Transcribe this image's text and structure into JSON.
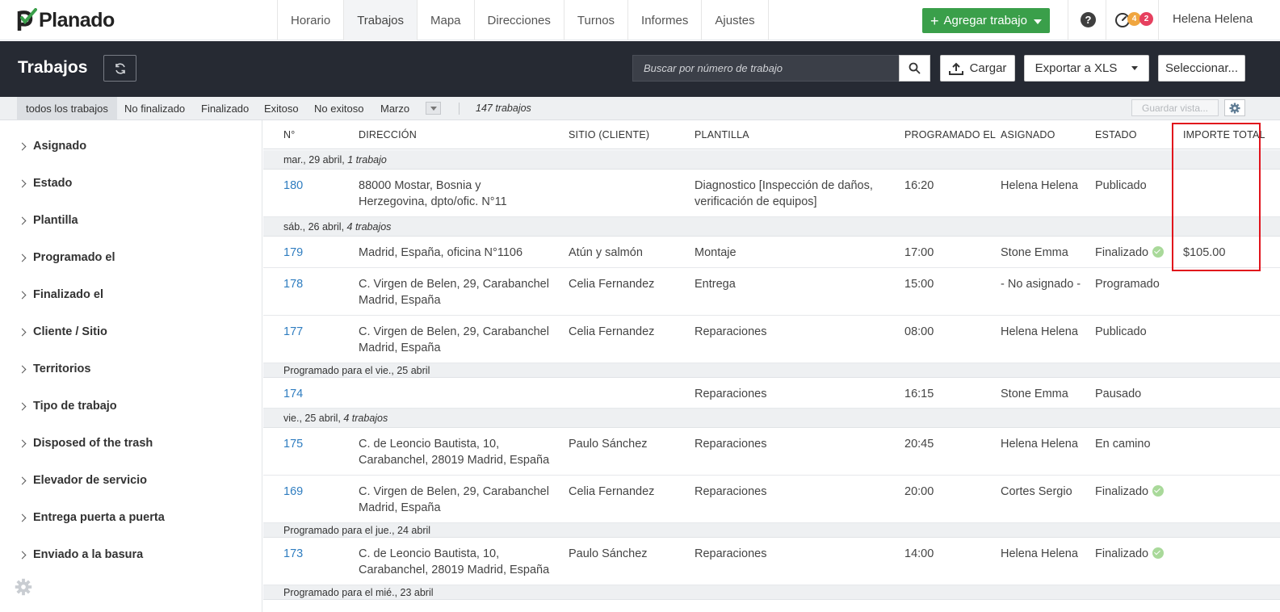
{
  "app": {
    "logo_text": "Planado",
    "brand_color": "#3a9f4a"
  },
  "nav": {
    "tabs": [
      "Horario",
      "Trabajos",
      "Mapa",
      "Direcciones",
      "Turnos",
      "Informes",
      "Ajustes"
    ],
    "active_tab": "Trabajos",
    "add_job_label": "Agregar trabajo",
    "help_label": "?",
    "badge_warning": "4",
    "badge_alert": "2",
    "user_name": "Helena Helena"
  },
  "header": {
    "title": "Trabajos",
    "search_placeholder": "Buscar por número de trabajo",
    "upload_label": "Cargar",
    "export_label": "Exportar a XLS",
    "select_label": "Seleccionar..."
  },
  "filters": {
    "items": [
      "todos los trabajos",
      "No finalizado",
      "Finalizado",
      "Exitoso",
      "No exitoso",
      "Marzo"
    ],
    "active": "todos los trabajos",
    "count": "147 trabajos",
    "save_view_label": "Guardar vista..."
  },
  "sidebar": {
    "items": [
      "Asignado",
      "Estado",
      "Plantilla",
      "Programado el",
      "Finalizado el",
      "Cliente / Sitio",
      "Territorios",
      "Tipo de trabajo",
      "Disposed of the trash",
      "Elevador de servicio",
      "Entrega puerta a puerta",
      "Enviado a la basura"
    ]
  },
  "table": {
    "columns": [
      "N°",
      "DIRECCIÓN",
      "SITIO (CLIENTE)",
      "PLANTILLA",
      "PROGRAMADO EL",
      "ASIGNADO",
      "ESTADO",
      "IMPORTE TOTAL"
    ],
    "groups": [
      {
        "label": "mar., 29 abril,",
        "count": "1 trabajo"
      },
      {
        "label": "sáb., 26 abril,",
        "count": "4 trabajos"
      },
      {
        "label": "Programado para el vie., 25 abril",
        "count": ""
      },
      {
        "label": "vie., 25 abril,",
        "count": "4 trabajos"
      },
      {
        "label": "Programado para el jue., 24 abril",
        "count": ""
      },
      {
        "label": "Programado para el mié., 23 abril",
        "count": ""
      }
    ],
    "rows": [
      {
        "num": "180",
        "address_1": "88000 Mostar, Bosnia y",
        "address_2": "Herzegovina, dpto/ofic. N°11",
        "site": "",
        "template_1": "Diagnostico [Inspección de daños,",
        "template_2": "verificación de equipos]",
        "time": "16:20",
        "assignee": "Helena Helena",
        "status": "Publicado",
        "amount": ""
      },
      {
        "num": "179",
        "address_1": "Madrid, España, oficina N°1106",
        "address_2": "",
        "site": "Atún y salmón",
        "template_1": "Montaje",
        "template_2": "",
        "time": "17:00",
        "assignee": "Stone Emma",
        "status": "Finalizado",
        "amount": "$105.00"
      },
      {
        "num": "178",
        "address_1": "C. Virgen de Belen, 29, Carabanchel",
        "address_2": "Madrid, España",
        "site": "Celia Fernandez",
        "template_1": "Entrega",
        "template_2": "",
        "time": "15:00",
        "assignee": "- No asignado -",
        "status": "Programado",
        "amount": ""
      },
      {
        "num": "177",
        "address_1": "C. Virgen de Belen, 29, Carabanchel",
        "address_2": "Madrid, España",
        "site": "Celia Fernandez",
        "template_1": "Reparaciones",
        "template_2": "",
        "time": "08:00",
        "assignee": "Helena Helena",
        "status": "Publicado",
        "amount": ""
      },
      {
        "num": "174",
        "address_1": "",
        "address_2": "",
        "site": "",
        "template_1": "Reparaciones",
        "template_2": "",
        "time": "16:15",
        "assignee": "Stone Emma",
        "status": "Pausado",
        "amount": ""
      },
      {
        "num": "175",
        "address_1": "C. de Leoncio Bautista, 10,",
        "address_2": "Carabanchel, 28019 Madrid, España",
        "site": "Paulo Sánchez",
        "template_1": "Reparaciones",
        "template_2": "",
        "time": "20:45",
        "assignee": "Helena Helena",
        "status": "En camino",
        "amount": ""
      },
      {
        "num": "169",
        "address_1": "C. Virgen de Belen, 29, Carabanchel",
        "address_2": "Madrid, España",
        "site": "Celia Fernandez",
        "template_1": "Reparaciones",
        "template_2": "",
        "time": "20:00",
        "assignee": "Cortes Sergio",
        "status": "Finalizado",
        "amount": ""
      },
      {
        "num": "173",
        "address_1": "C. de Leoncio Bautista, 10,",
        "address_2": "Carabanchel, 28019 Madrid, España",
        "site": "Paulo Sánchez",
        "template_1": "Reparaciones",
        "template_2": "",
        "time": "14:00",
        "assignee": "Helena Helena",
        "status": "Finalizado",
        "amount": ""
      }
    ]
  },
  "colors": {
    "link": "#2f7dc0",
    "dark_header": "#262a33",
    "success_check": "#a9d99a",
    "highlight": "#e1131c"
  }
}
